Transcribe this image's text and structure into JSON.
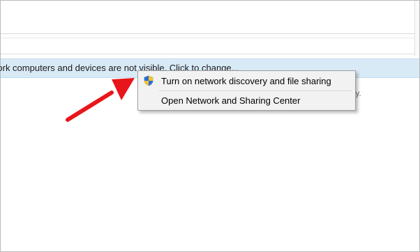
{
  "info_bar": {
    "text": "work computers and devices are not visible. Click to change..."
  },
  "background_text": {
    "fragment": "ty."
  },
  "context_menu": {
    "items": [
      {
        "label": "Turn on network discovery and file sharing",
        "icon": "uac-shield-icon"
      },
      {
        "label": "Open Network and Sharing Center"
      }
    ]
  },
  "annotation": {
    "arrow_color": "#e8161b"
  },
  "colors": {
    "info_bar_bg": "#d9eaf7",
    "menu_bg": "#f2f2f2"
  }
}
